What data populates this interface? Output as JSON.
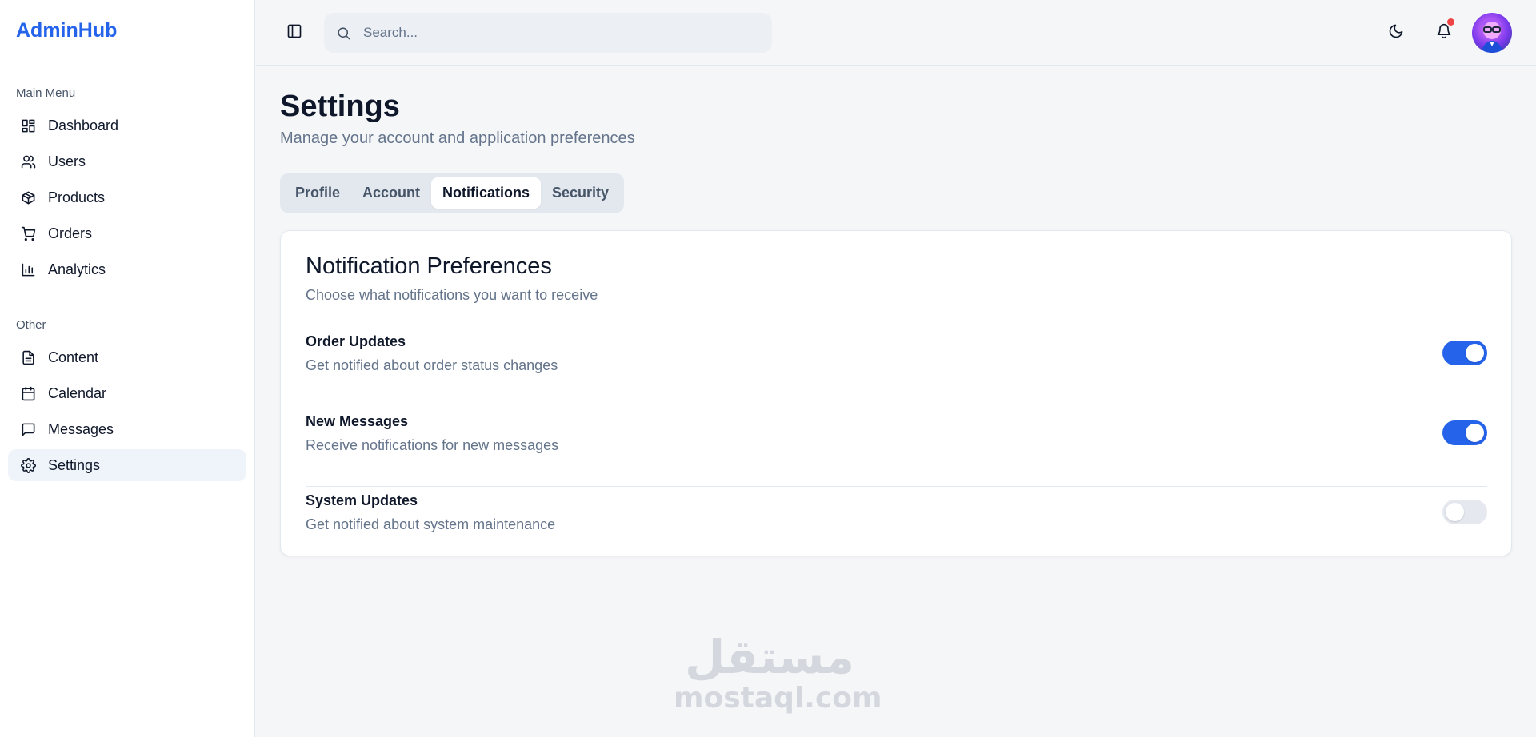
{
  "sidebar": {
    "brand": "AdminHub",
    "main_menu_label": "Main Menu",
    "main_items": [
      {
        "label": "Dashboard",
        "icon": "dashboard-icon"
      },
      {
        "label": "Users",
        "icon": "users-icon"
      },
      {
        "label": "Products",
        "icon": "package-icon"
      },
      {
        "label": "Orders",
        "icon": "cart-icon"
      },
      {
        "label": "Analytics",
        "icon": "bar-chart-icon"
      }
    ],
    "other_label": "Other",
    "other_items": [
      {
        "label": "Content",
        "icon": "document-icon"
      },
      {
        "label": "Calendar",
        "icon": "calendar-icon"
      },
      {
        "label": "Messages",
        "icon": "message-icon"
      },
      {
        "label": "Settings",
        "icon": "gear-icon",
        "active": true
      }
    ]
  },
  "topbar": {
    "search_placeholder": "Search...",
    "notification_dot_color": "#ef4444"
  },
  "page": {
    "title": "Settings",
    "subtitle": "Manage your account and application preferences"
  },
  "tabs": [
    {
      "label": "Profile"
    },
    {
      "label": "Account"
    },
    {
      "label": "Notifications",
      "active": true
    },
    {
      "label": "Security"
    }
  ],
  "card": {
    "title": "Notification Preferences",
    "description": "Choose what notifications you want to receive",
    "preferences": [
      {
        "title": "Order Updates",
        "description": "Get notified about order status changes",
        "enabled": true
      },
      {
        "title": "New Messages",
        "description": "Receive notifications for new messages",
        "enabled": true
      },
      {
        "title": "System Updates",
        "description": "Get notified about system maintenance",
        "enabled": false
      }
    ]
  },
  "watermark": {
    "arabic": "مستقل",
    "latin": "mostaql.com"
  },
  "colors": {
    "accent": "#2563eb",
    "toggle_off": "#e5e9ef"
  }
}
